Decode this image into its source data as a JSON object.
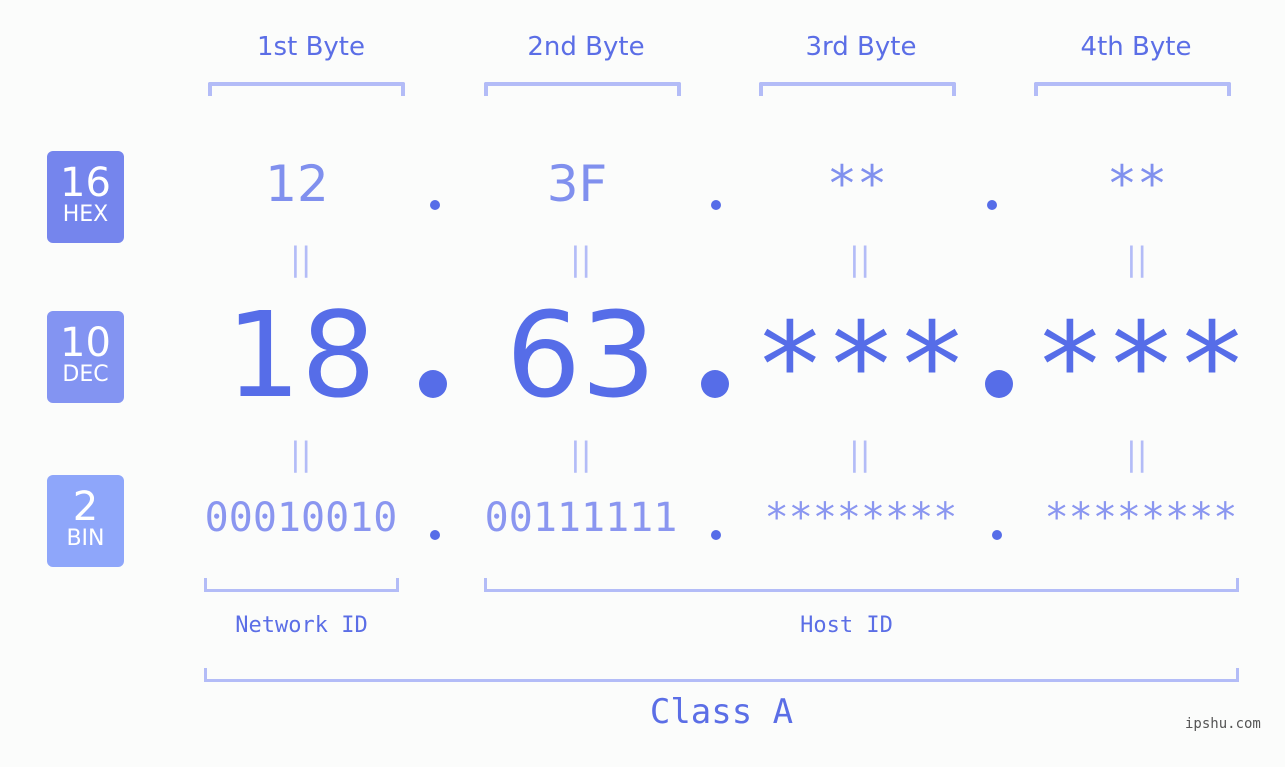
{
  "byte_headers": [
    "1st Byte",
    "2nd Byte",
    "3rd Byte",
    "4th Byte"
  ],
  "badges": [
    {
      "base": "16",
      "label": "HEX",
      "color": "#7585ed"
    },
    {
      "base": "10",
      "label": "DEC",
      "color": "#8394f2"
    },
    {
      "base": "2",
      "label": "BIN",
      "color": "#8ea6fa"
    }
  ],
  "hex": [
    "12",
    "3F",
    "**",
    "**"
  ],
  "dec": [
    "18",
    "63",
    "***",
    "***"
  ],
  "bin": [
    "00010010",
    "00111111",
    "********",
    "********"
  ],
  "equals_symbol": "||",
  "network_id_label": "Network ID",
  "host_id_label": "Host ID",
  "class_label": "Class A",
  "watermark": "ipshu.com",
  "colors": {
    "accent": "#566de8",
    "bracket": "#b3bcf7",
    "hex_text": "#8090ee",
    "bin_text": "#8a96f0",
    "background": "#fbfcfb"
  }
}
